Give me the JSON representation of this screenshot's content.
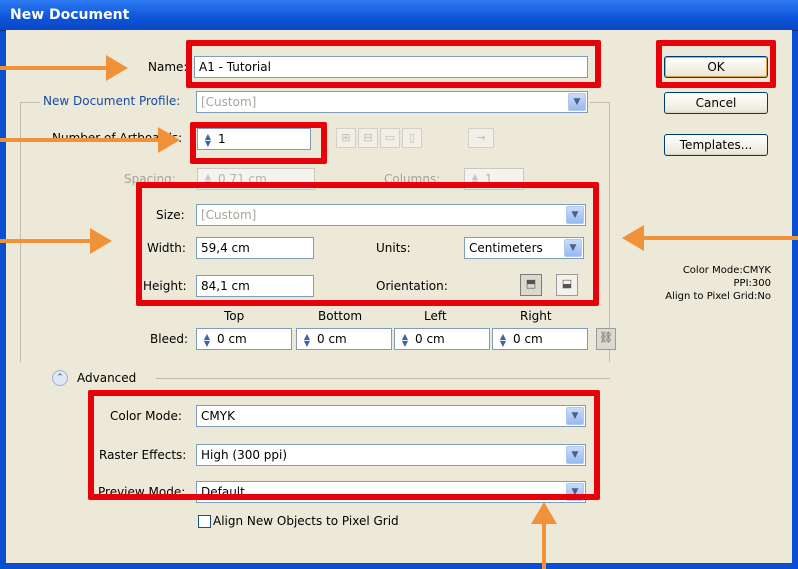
{
  "window": {
    "title": "New Document"
  },
  "name": {
    "label": "Name:",
    "value": "A1 - Tutorial"
  },
  "profile": {
    "label": "New Document Profile:",
    "value": "[Custom]"
  },
  "artboards": {
    "label": "Number of Artboards:",
    "value": "1"
  },
  "spacing": {
    "label": "Spacing:",
    "value": "0,71 cm"
  },
  "columns": {
    "label": "Columns:",
    "value": "1"
  },
  "size": {
    "label": "Size:",
    "value": "[Custom]"
  },
  "width": {
    "label": "Width:",
    "value": "59,4 cm"
  },
  "height": {
    "label": "Height:",
    "value": "84,1 cm"
  },
  "units": {
    "label": "Units:",
    "value": "Centimeters"
  },
  "orientation": {
    "label": "Orientation:"
  },
  "bleed": {
    "label": "Bleed:",
    "headers": [
      "Top",
      "Bottom",
      "Left",
      "Right"
    ],
    "values": [
      "0 cm",
      "0 cm",
      "0 cm",
      "0 cm"
    ]
  },
  "advanced": {
    "label": "Advanced"
  },
  "color_mode": {
    "label": "Color Mode:",
    "value": "CMYK"
  },
  "raster_effects": {
    "label": "Raster Effects:",
    "value": "High (300 ppi)"
  },
  "preview_mode": {
    "label": "Preview Mode:",
    "value": "Default"
  },
  "align_pixel_grid": {
    "label": "Align New Objects to Pixel Grid",
    "checked": false
  },
  "buttons": {
    "ok": "OK",
    "cancel": "Cancel",
    "templates": "Templates..."
  },
  "summary": {
    "color_mode": "Color Mode:CMYK",
    "ppi": "PPI:300",
    "align": "Align to Pixel Grid:No"
  },
  "colors": {
    "highlight": "#e8000b",
    "arrow": "#f0923a",
    "title_bar": "#0b4fd0"
  },
  "icons": [
    "spin-icon",
    "dropdown-icon",
    "portrait-icon",
    "landscape-icon",
    "link-icon",
    "collapse-icon"
  ]
}
